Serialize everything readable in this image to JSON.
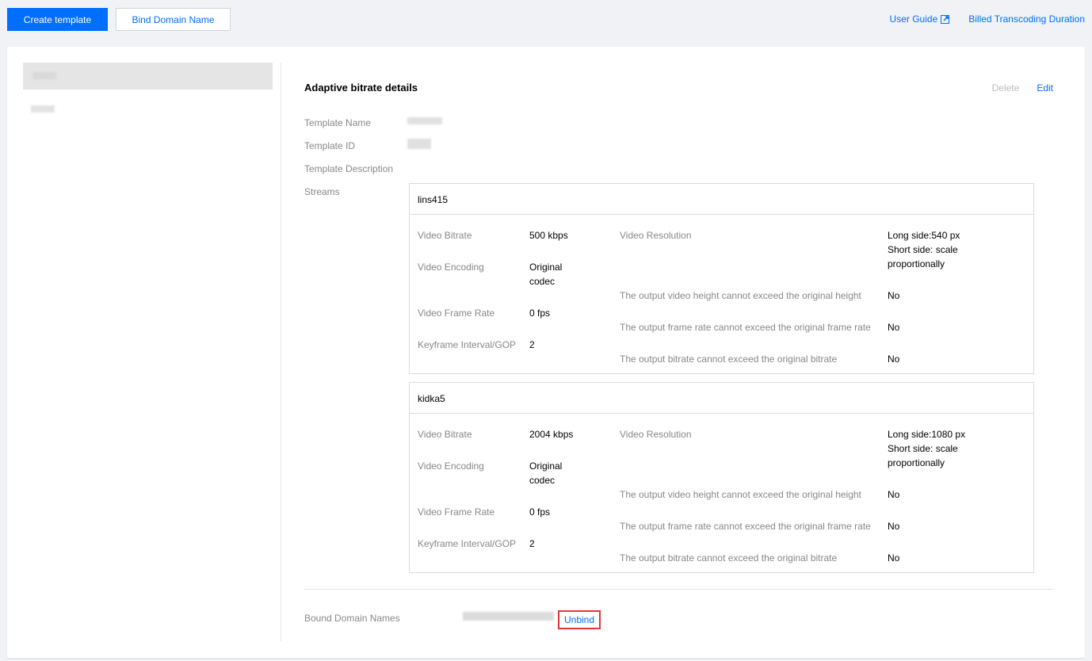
{
  "toolbar": {
    "create_label": "Create template",
    "bind_label": "Bind Domain Name",
    "user_guide_label": "User Guide",
    "billed_label": "Billed Transcoding Duration"
  },
  "detail": {
    "title": "Adaptive bitrate details",
    "delete_label": "Delete",
    "edit_label": "Edit",
    "template_name_label": "Template Name",
    "template_id_label": "Template ID",
    "template_desc_label": "Template Description",
    "streams_label": "Streams",
    "bound_domains_label": "Bound Domain Names",
    "unbind_label": "Unbind"
  },
  "labels": {
    "video_bitrate": "Video Bitrate",
    "video_encoding": "Video Encoding",
    "video_frame_rate": "Video Frame Rate",
    "keyframe_interval": "Keyframe Interval/GOP",
    "video_resolution": "Video Resolution",
    "height_limit": "The output video height cannot exceed the original height",
    "framerate_limit": "The output frame rate cannot exceed the original frame rate",
    "bitrate_limit": "The output bitrate cannot exceed the original bitrate"
  },
  "streams": [
    {
      "name": "lins415",
      "bitrate": "500 kbps",
      "encoding_line1": "Original",
      "encoding_line2": "codec",
      "frame_rate": "0 fps",
      "gop": "2",
      "res_line1": "Long side:540 px",
      "res_line2": "Short side: scale",
      "res_line3": "proportionally",
      "height_limit": "No",
      "framerate_limit": "No",
      "bitrate_limit": "No"
    },
    {
      "name": "kidka5",
      "bitrate": "2004 kbps",
      "encoding_line1": "Original",
      "encoding_line2": "codec",
      "frame_rate": "0 fps",
      "gop": "2",
      "res_line1": "Long side:1080 px",
      "res_line2": "Short side: scale",
      "res_line3": "proportionally",
      "height_limit": "No",
      "framerate_limit": "No",
      "bitrate_limit": "No"
    }
  ],
  "icons": {
    "external": "external-link-icon"
  },
  "colors": {
    "primary": "#006eff",
    "highlight": "#e5363b"
  }
}
